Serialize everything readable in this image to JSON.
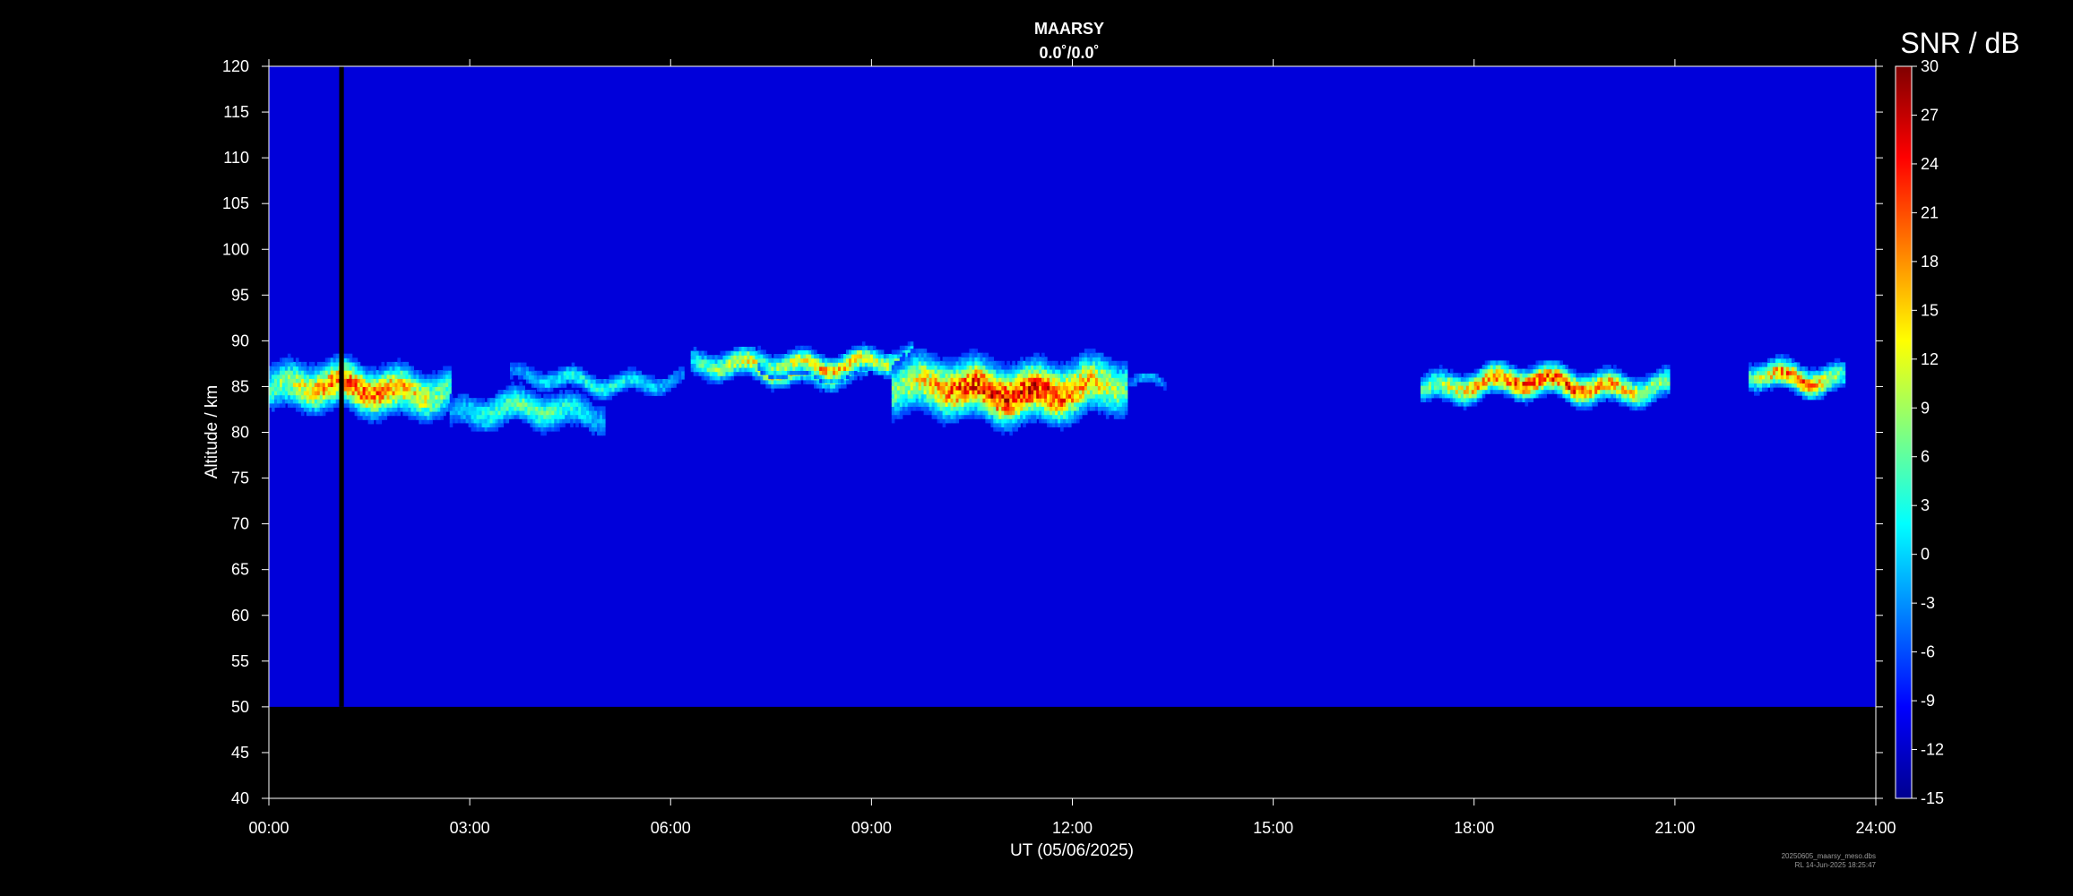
{
  "chart_data": {
    "type": "heatmap",
    "title": "MAARSY",
    "subtitle": "0.0˚/0.0˚",
    "xlabel": "UT (05/06/2025)",
    "ylabel": "Altitude / km",
    "xlim": [
      0,
      24
    ],
    "ylim": [
      40,
      120
    ],
    "x_tick_labels": [
      "00:00",
      "03:00",
      "06:00",
      "09:00",
      "12:00",
      "15:00",
      "18:00",
      "21:00",
      "24:00"
    ],
    "y_tick_labels": [
      "40",
      "45",
      "50",
      "55",
      "60",
      "65",
      "70",
      "75",
      "80",
      "85",
      "90",
      "95",
      "100",
      "105",
      "110",
      "115",
      "120"
    ],
    "data_altitude_range_km": [
      50,
      120
    ],
    "data_gap_hours": [
      1.05,
      1.12
    ],
    "colorbar": {
      "title": "SNR / dB",
      "range": [
        -15,
        30
      ],
      "colormap": "jet",
      "tick_labels": [
        "-15",
        "-12",
        "-9",
        "-6",
        "-3",
        "0",
        "3",
        "6",
        "9",
        "12",
        "15",
        "18",
        "21",
        "24",
        "27",
        "30"
      ]
    },
    "background_snr_db": -11,
    "echo_regions": [
      {
        "t_start": 0.0,
        "t_end": 2.7,
        "alt_center_km": 84.5,
        "alt_halfwidth_km": 2.5,
        "peak_snr_db": 24
      },
      {
        "t_start": 2.7,
        "t_end": 5.0,
        "alt_center_km": 82.0,
        "alt_halfwidth_km": 2.0,
        "peak_snr_db": 8
      },
      {
        "t_start": 3.6,
        "t_end": 6.2,
        "alt_center_km": 85.5,
        "alt_halfwidth_km": 1.2,
        "peak_snr_db": 5
      },
      {
        "t_start": 6.3,
        "t_end": 8.9,
        "alt_center_km": 86.8,
        "alt_halfwidth_km": 1.5,
        "peak_snr_db": 18
      },
      {
        "t_start": 7.3,
        "t_end": 9.6,
        "alt_center_km": 87.5,
        "alt_halfwidth_km": 1.3,
        "peak_snr_db": 20
      },
      {
        "t_start": 9.3,
        "t_end": 12.8,
        "alt_center_km": 84.5,
        "alt_halfwidth_km": 3.0,
        "peak_snr_db": 29
      },
      {
        "t_start": 12.8,
        "t_end": 13.4,
        "alt_center_km": 85.0,
        "alt_halfwidth_km": 0.8,
        "peak_snr_db": 0
      },
      {
        "t_start": 17.2,
        "t_end": 20.9,
        "alt_center_km": 85.0,
        "alt_halfwidth_km": 1.6,
        "peak_snr_db": 26
      },
      {
        "t_start": 22.1,
        "t_end": 23.5,
        "alt_center_km": 86.0,
        "alt_halfwidth_km": 1.5,
        "peak_snr_db": 24
      }
    ]
  },
  "footer": {
    "line1": "20250605_maarsy_meso.dbs",
    "line2": "RL  14-Jun-2025 18:25:47"
  }
}
